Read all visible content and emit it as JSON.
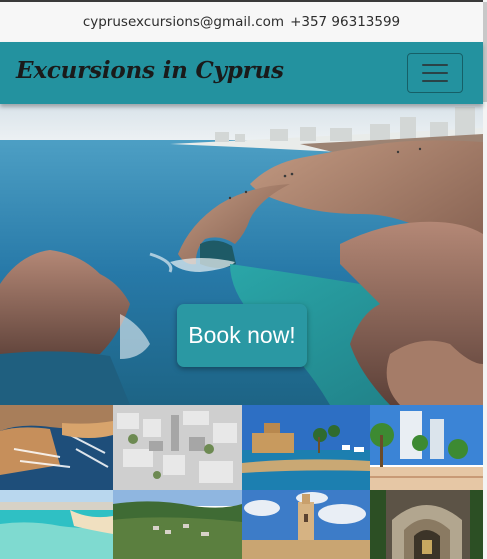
{
  "contact": {
    "email": "cyprusexcursions@gmail.com",
    "phone": "+357 96313599"
  },
  "navbar": {
    "brand": "Excursions in Cyprus",
    "toggler_icon": "hamburger-menu-icon"
  },
  "hero": {
    "image_subject": "sea-cliffs-and-rock-arch",
    "cta_label": "Book now!"
  },
  "gallery": {
    "tiles": [
      {
        "name": "gallery-tile-marina",
        "subject": "aerial-marina"
      },
      {
        "name": "gallery-tile-city",
        "subject": "aerial-city"
      },
      {
        "name": "gallery-tile-harbour-fort",
        "subject": "harbour-fort"
      },
      {
        "name": "gallery-tile-palm-promenade",
        "subject": "palm-promenade"
      },
      {
        "name": "gallery-tile-beach",
        "subject": "turquoise-beach"
      },
      {
        "name": "gallery-tile-forest-village",
        "subject": "forest-village"
      },
      {
        "name": "gallery-tile-church-tower",
        "subject": "church-bell-tower"
      },
      {
        "name": "gallery-tile-monastery",
        "subject": "monastery-arch"
      }
    ]
  },
  "colors": {
    "navbar": "#23929f",
    "button": "#2a98a3",
    "contact_bar": "#f7f7f7"
  }
}
